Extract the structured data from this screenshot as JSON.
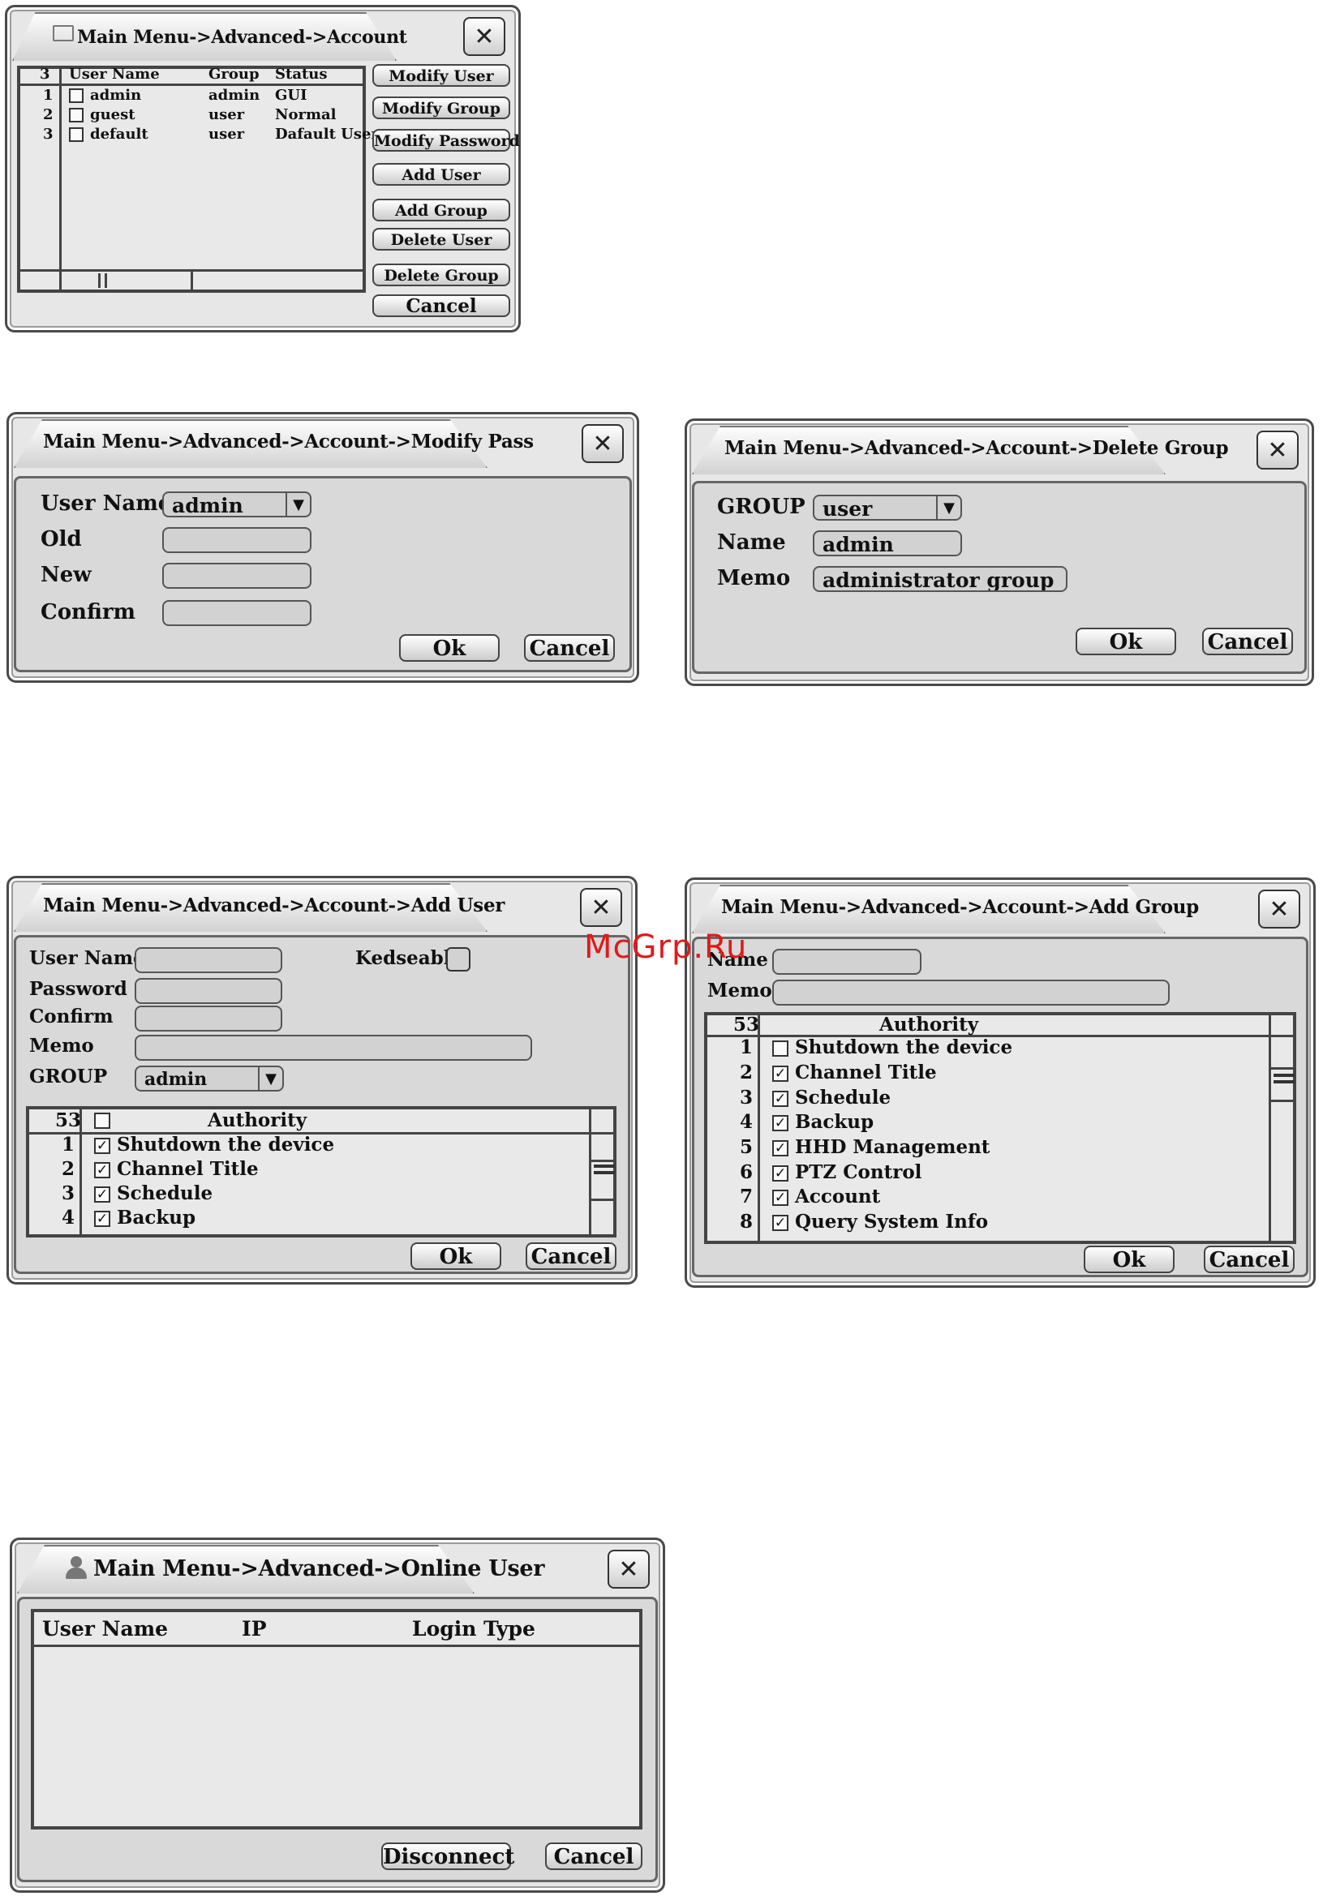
{
  "account": {
    "title": "Main Menu->Advanced->Account",
    "count": "3",
    "headers": [
      "User Name",
      "Group",
      "Status"
    ],
    "rows": [
      {
        "num": "1",
        "user": "admin",
        "group": "admin",
        "status": "GUI"
      },
      {
        "num": "2",
        "user": "guest",
        "group": "user",
        "status": "Normal"
      },
      {
        "num": "3",
        "user": "default",
        "group": "user",
        "status": "Dafault User"
      }
    ],
    "buttons": [
      "Modify User",
      "Modify Group",
      "Modify Password",
      "Add User",
      "Add Group",
      "Delete User",
      "Delete Group",
      "Cancel"
    ]
  },
  "modify_pass": {
    "title": "Main Menu->Advanced->Account->Modify Pass",
    "user_name_label": "User Name",
    "user_name_value": "admin",
    "old_label": "Old",
    "new_label": "New",
    "confirm_label": "Confirm",
    "ok": "Ok",
    "cancel": "Cancel"
  },
  "delete_group": {
    "title": "Main Menu->Advanced->Account->Delete Group",
    "group_label": "GROUP",
    "group_value": "user",
    "name_label": "Name",
    "name_value": "admin",
    "memo_label": "Memo",
    "memo_value": "administrator group",
    "ok": "Ok",
    "cancel": "Cancel"
  },
  "add_user": {
    "title": "Main Menu->Advanced->Account->Add User",
    "user_name_label": "User Name",
    "kedseable_label": "Kedseable",
    "password_label": "Password",
    "confirm_label": "Confirm",
    "memo_label": "Memo",
    "group_label": "GROUP",
    "group_value": "admin",
    "count": "53",
    "authority_header": "Authority",
    "rows": [
      {
        "num": "1",
        "name": "Shutdown the device",
        "checked": true
      },
      {
        "num": "2",
        "name": "Channel Title",
        "checked": true
      },
      {
        "num": "3",
        "name": "Schedule",
        "checked": true
      },
      {
        "num": "4",
        "name": "Backup",
        "checked": true
      }
    ],
    "ok": "Ok",
    "cancel": "Cancel"
  },
  "add_group": {
    "title": "Main Menu->Advanced->Account->Add Group",
    "name_label": "Name",
    "memo_label": "Memo",
    "count": "53",
    "authority_header": "Authority",
    "rows": [
      {
        "num": "1",
        "name": "Shutdown the device",
        "checked": false
      },
      {
        "num": "2",
        "name": "Channel Title",
        "checked": true
      },
      {
        "num": "3",
        "name": "Schedule",
        "checked": true
      },
      {
        "num": "4",
        "name": "Backup",
        "checked": true
      },
      {
        "num": "5",
        "name": "HHD Management",
        "checked": true
      },
      {
        "num": "6",
        "name": "PTZ Control",
        "checked": true
      },
      {
        "num": "7",
        "name": "Account",
        "checked": true
      },
      {
        "num": "8",
        "name": "Query System Info",
        "checked": true
      }
    ],
    "ok": "Ok",
    "cancel": "Cancel"
  },
  "online_user": {
    "title": "Main Menu->Advanced->Online User",
    "headers": [
      "User Name",
      "IP",
      "Login Type"
    ],
    "disconnect": "Disconnect",
    "cancel": "Cancel"
  },
  "watermark": "McGrp.Ru",
  "icons": {
    "close": "close-icon",
    "dropdown": "chevron-down-icon",
    "checkbox": "checkbox-icon"
  }
}
